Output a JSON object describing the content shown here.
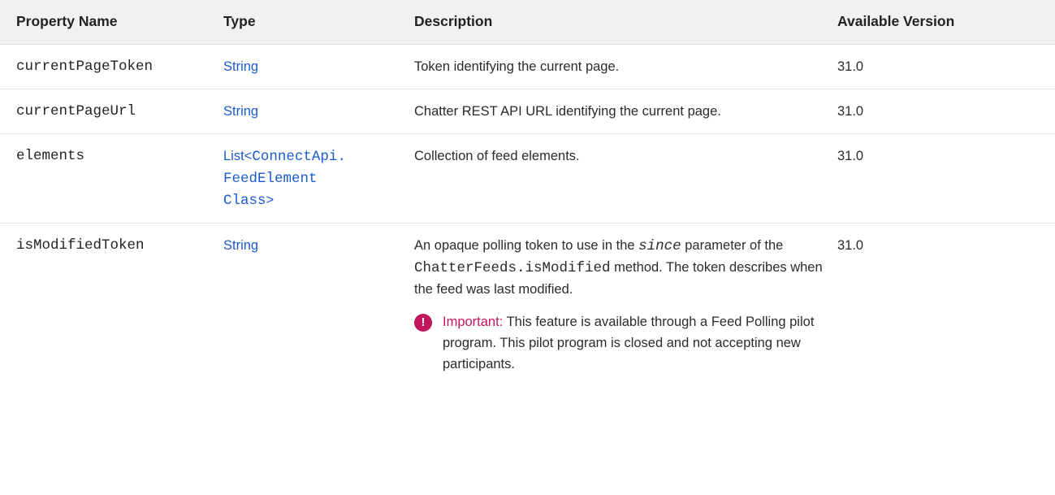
{
  "headers": {
    "property_name": "Property Name",
    "type": "Type",
    "description": "Description",
    "available_version": "Available Version"
  },
  "rows": [
    {
      "property": "currentPageToken",
      "type": "String",
      "description": "Token identifying the current page.",
      "version": "31.0"
    },
    {
      "property": "currentPageUrl",
      "type": "String",
      "description": "Chatter REST API URL identifying the current page.",
      "version": "31.0"
    },
    {
      "property": "elements",
      "type_prefix": "List<",
      "type_line1": "ConnectApi.",
      "type_line2": "FeedElement",
      "type_line3": "Class",
      "type_suffix": ">",
      "description": "Collection of feed elements.",
      "version": "31.0"
    },
    {
      "property": "isModifiedToken",
      "type": "String",
      "description_part1": "An opaque polling token to use in the",
      "description_param": "since",
      "description_part2": "parameter of the",
      "description_code": "ChatterFeeds.isModified",
      "description_part3": "method. The token describes when the feed was last modified.",
      "note_icon": "!",
      "note_label": "Important:",
      "note_text": "This feature is available through a Feed Polling pilot program. This pilot program is closed and not accepting new participants.",
      "version": "31.0"
    }
  ],
  "colors": {
    "link": "#1a5bd0",
    "important": "#c2185b",
    "header_bg": "#f1f1f1"
  }
}
